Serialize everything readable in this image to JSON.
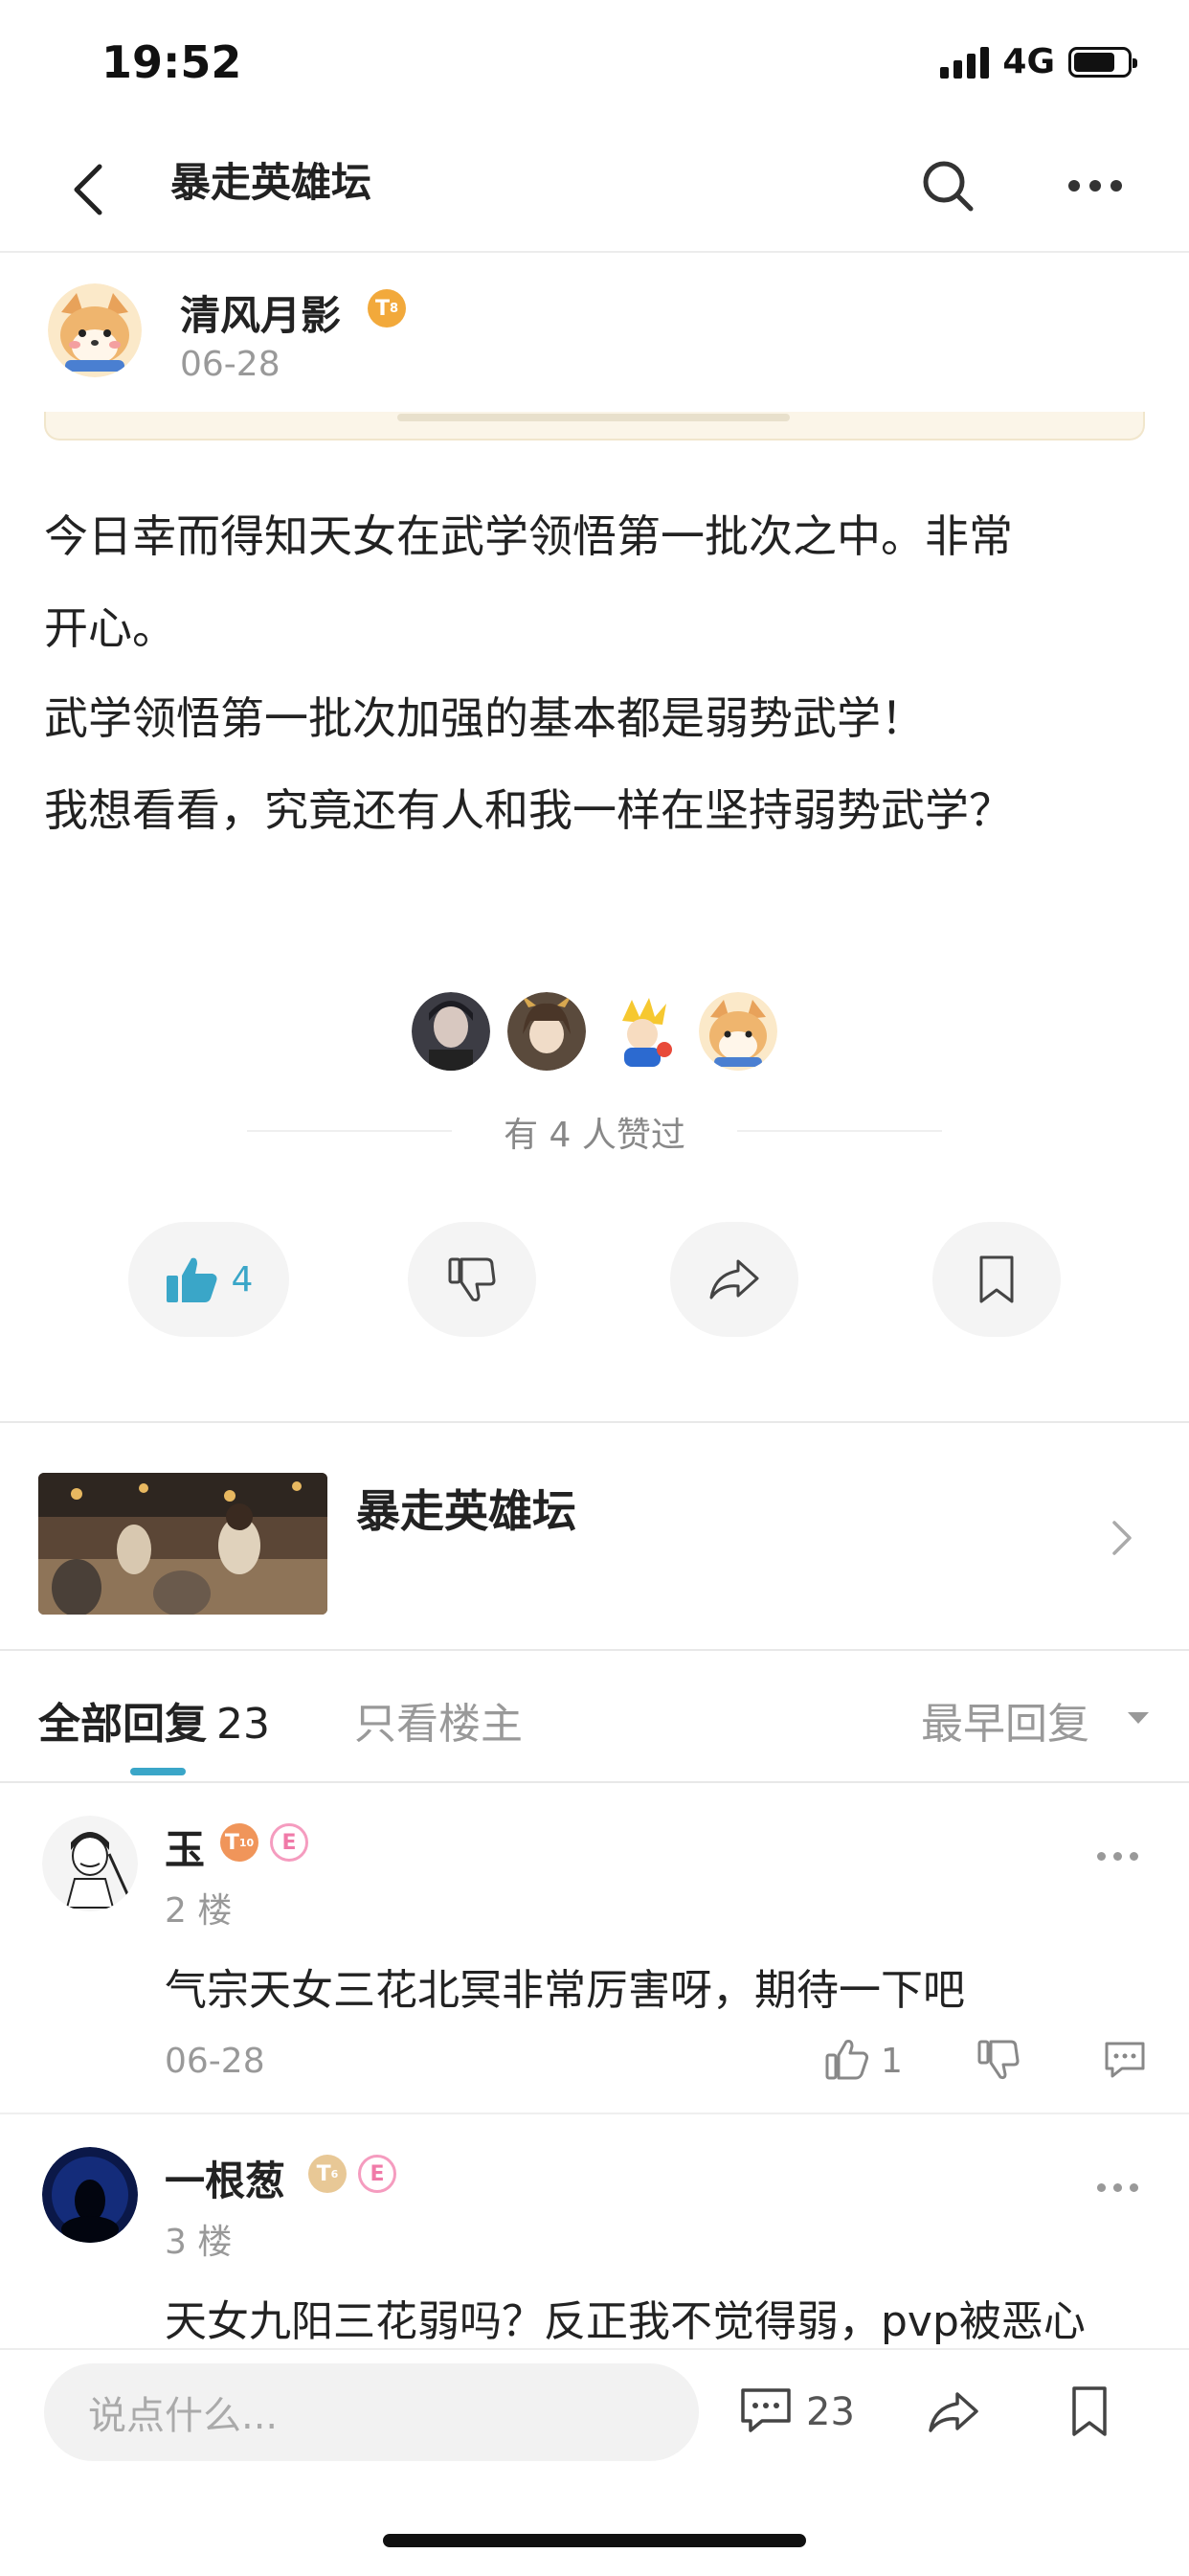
{
  "status_bar": {
    "time": "19:52",
    "network": "4G"
  },
  "nav": {
    "title": "暴走英雄坛",
    "back_icon": "chevron-left-icon",
    "search_icon": "search-icon",
    "more_icon": "more-icon"
  },
  "post": {
    "author_name": "清风月影",
    "author_level": "8",
    "date": "06-28",
    "lines": [
      "今日幸而得知天女在武学领悟第一批次之中。非常",
      "开心。",
      "武学领悟第一批次加强的基本都是弱势武学！",
      "我想看看，究竟还有人和我一样在坚持弱势武学？"
    ]
  },
  "likers": {
    "text": "有 4 人赞过"
  },
  "actions": {
    "like_count": "4"
  },
  "forum": {
    "name": "暴走英雄坛"
  },
  "replies": {
    "tab_all": "全部回复",
    "count": "23",
    "tab_op": "只看楼主",
    "sort": "最早回复"
  },
  "comments": [
    {
      "name": "玉",
      "level": "10",
      "floor": "2 楼",
      "text": "气宗天女三花北冥非常厉害呀，期待一下吧",
      "date": "06-28",
      "likes": "1"
    },
    {
      "name": "一根葱",
      "level": "6",
      "floor": "3 楼",
      "text": "天女九阳三花弱吗？反正我不觉得弱，pvp被恶心"
    }
  ],
  "bottom": {
    "placeholder": "说点什么...",
    "comment_count": "23"
  },
  "colors": {
    "accent": "#3aa6c8",
    "badge_gold": "#f2a93b",
    "badge_orange": "#f0955a",
    "badge_pink": "#f59cbf"
  }
}
